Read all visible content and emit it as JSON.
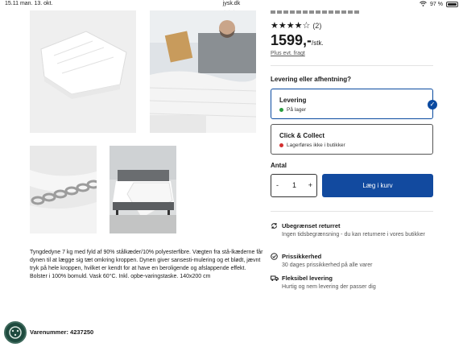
{
  "status": {
    "time": "15.11  man. 13. okt.",
    "url": "jysk.dk",
    "battery": "97 %"
  },
  "product": {
    "rating_stars": "★★★★☆",
    "rating_count": "(2)",
    "price": "1599,-",
    "price_unit": "/stk.",
    "freight_link": "Plus evt. fragt"
  },
  "delivery": {
    "question": "Levering eller afhentning?",
    "options": [
      {
        "label": "Levering",
        "stock": "På lager",
        "dot_color": "#2a9d3f"
      },
      {
        "label": "Click & Collect",
        "stock": "Lagerføres ikke i butikker",
        "dot_color": "#d32f2f"
      }
    ]
  },
  "quantity": {
    "label": "Antal",
    "minus": "-",
    "value": "1",
    "plus": "+"
  },
  "cart": {
    "label": "Læg i kurv"
  },
  "benefits": [
    {
      "icon": "return-icon",
      "title": "Ubegrænset returret",
      "text": "Ingen tidsbegrænsning - du kan returnere i vores butikker"
    },
    {
      "icon": "check-circle-icon",
      "title": "Prissikkerhed",
      "text": "30 dages prissikkerhed på alle varer"
    },
    {
      "icon": "truck-icon",
      "title": "Fleksibel levering",
      "text": "Hurtig og nem levering der passer dig"
    }
  ],
  "description": "Tyngdedyne 7 kg med fyld af 90% stålkæder/10% polyesterfibre. Vægten fra stå-lkæderne får dynen til at lægge sig tæt omkring kroppen. Dynen giver sansesti-mulering og et blødt, jævnt tryk på hele kroppen, hvilket er kendt for at have en beroligende og afslappende effekt. Bolster i 100% bomuld. Vask 60°C. Inkl. opbe-varingstaske. 140x200 cm",
  "sku": "Varenummer: 4237250",
  "colors": {
    "brand_blue": "#124a9f",
    "selected_border": "#0a4aa0"
  }
}
